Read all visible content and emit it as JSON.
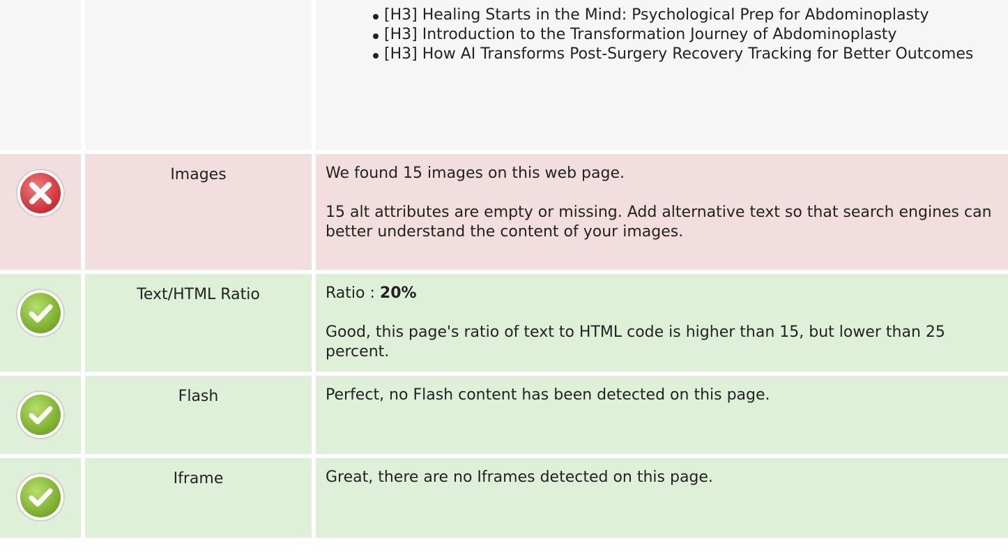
{
  "headings_list": [
    "[H3] Healing Starts in the Mind: Psychological Prep for Abdominoplasty",
    "[H3] Introduction to the Transformation Journey of Abdominoplasty",
    "[H3] How AI Transforms Post-Surgery Recovery Tracking for Better Outcomes"
  ],
  "images": {
    "label": "Images",
    "status": "fail",
    "line1": "We found 15 images on this web page.",
    "line2": "15 alt attributes are empty or missing. Add alternative text so that search engines can better understand the content of your images."
  },
  "text_html_ratio": {
    "label": "Text/HTML Ratio",
    "status": "pass",
    "ratio_prefix": "Ratio : ",
    "ratio_value": "20%",
    "description": "Good, this page's ratio of text to HTML code is higher than 15, but lower than 25 percent."
  },
  "flash": {
    "label": "Flash",
    "status": "pass",
    "description": "Perfect, no Flash content has been detected on this page."
  },
  "iframe": {
    "label": "Iframe",
    "status": "pass",
    "description": "Great, there are no Iframes detected on this page."
  },
  "colors": {
    "fail_bg": "#f2dedf",
    "pass_bg": "#dff0d8",
    "neutral_bg": "#f6f6f6",
    "fail_icon": "#e4393c",
    "pass_icon": "#8cc43c"
  }
}
